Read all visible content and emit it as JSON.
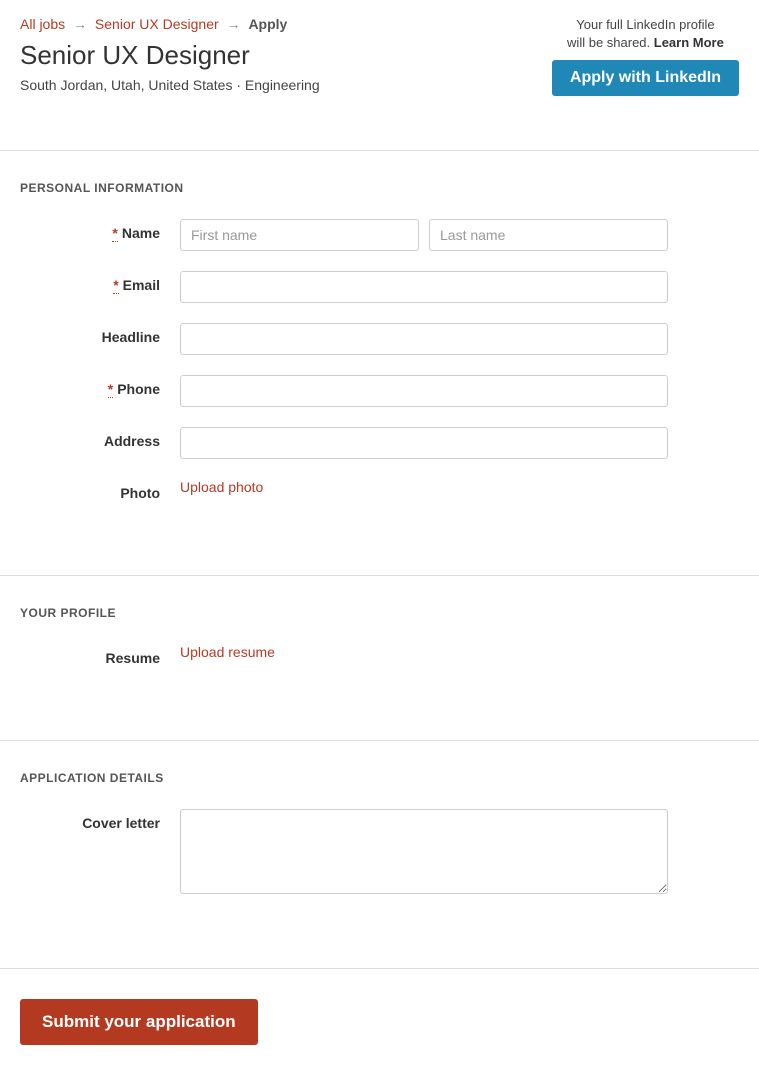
{
  "breadcrumb": {
    "all_jobs": "All jobs",
    "job_link": "Senior UX Designer",
    "current": "Apply",
    "arrow": "→"
  },
  "header": {
    "title": "Senior UX Designer",
    "location": "South Jordan, Utah, United States · Engineering"
  },
  "linkedin": {
    "note_line1": "Your full LinkedIn profile",
    "note_line2": "will be shared. ",
    "learn_more": "Learn More",
    "button": "Apply with LinkedIn"
  },
  "sections": {
    "personal": {
      "title": "PERSONAL INFORMATION",
      "name_label": "Name",
      "first_name_placeholder": "First name",
      "last_name_placeholder": "Last name",
      "email_label": "Email",
      "headline_label": "Headline",
      "phone_label": "Phone",
      "address_label": "Address",
      "photo_label": "Photo",
      "upload_photo": "Upload photo",
      "required_marker": "*"
    },
    "profile": {
      "title": "YOUR PROFILE",
      "resume_label": "Resume",
      "upload_resume": "Upload resume"
    },
    "details": {
      "title": "APPLICATION DETAILS",
      "cover_label": "Cover letter"
    }
  },
  "submit": {
    "button": "Submit your application"
  }
}
